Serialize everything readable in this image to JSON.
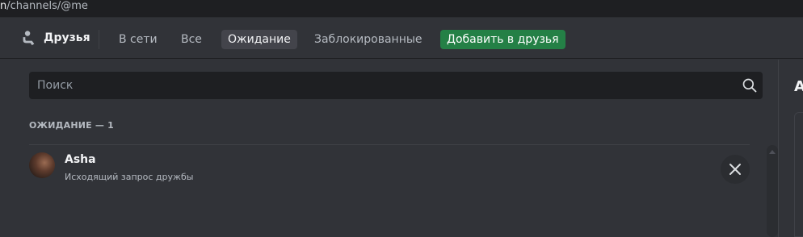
{
  "browser": {
    "url_prefix": "n",
    "url_path": "/channels/@me"
  },
  "nav": {
    "title": "Друзья",
    "tabs": [
      {
        "label": "В сети",
        "active": false
      },
      {
        "label": "Все",
        "active": false
      },
      {
        "label": "Ожидание",
        "active": true
      },
      {
        "label": "Заблокированные",
        "active": false
      }
    ],
    "add_friend_label": "Добавить в друзья"
  },
  "search": {
    "placeholder": "Поиск",
    "icon": "search-icon"
  },
  "pending": {
    "section_header": "ОЖИДАНИЕ — 1",
    "items": [
      {
        "username": "Asha",
        "status_text": "Исходящий запрос дружбы",
        "action_icon": "close-icon"
      }
    ]
  },
  "right_panel": {
    "heading_partial": "А"
  },
  "colors": {
    "background": "#313338",
    "accent_green": "#248046",
    "active_tab": "#43444b",
    "input_bg": "#1e1f22"
  }
}
